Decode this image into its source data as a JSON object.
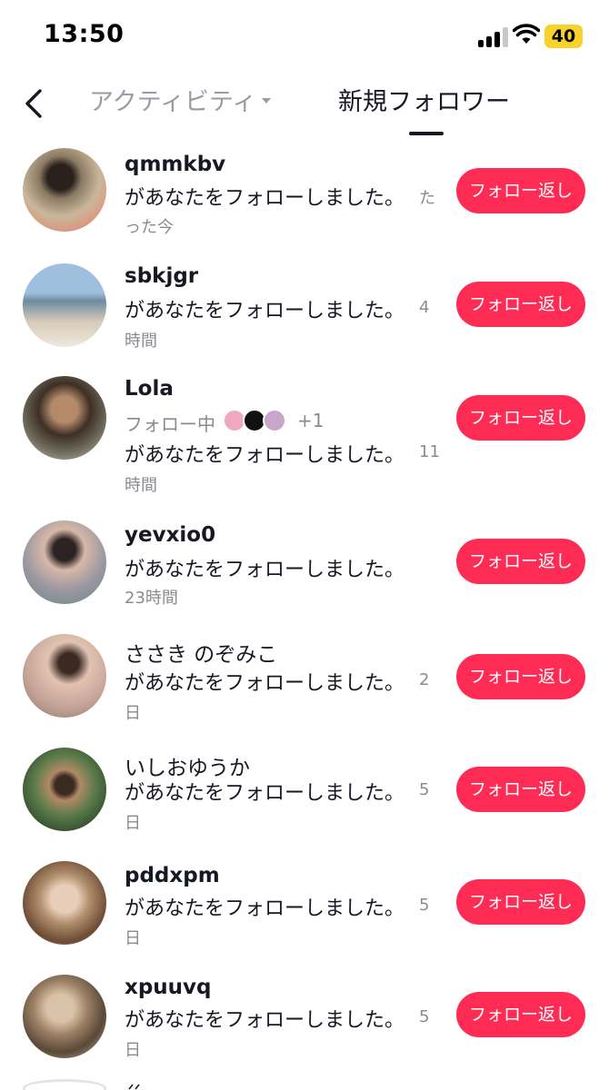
{
  "status_bar": {
    "time": "13:50",
    "battery": "40"
  },
  "header": {
    "tabs": [
      {
        "label": "アクティビティ",
        "active": false,
        "has_dropdown": true
      },
      {
        "label": "新規フォロワー",
        "active": true
      }
    ],
    "back_icon": "chevron-left-icon"
  },
  "colors": {
    "accent": "#fe2c55",
    "text_primary": "#161823",
    "text_secondary": "#8a8b91",
    "battery": "#f7d32a"
  },
  "followers": [
    {
      "username": "qmmkbv",
      "message": "があなたをフォローしました。",
      "time_inline": "た",
      "time_wrap": "った今",
      "button": "フォロー返し"
    },
    {
      "username": "sbkjgr",
      "message": "があなたをフォローしました。",
      "time_inline": "4",
      "time_wrap": "時間",
      "button": "フォロー返し"
    },
    {
      "username": "Lola",
      "following_label": "フォロー中",
      "following_more": "+1",
      "message": "があなたをフォローしました。",
      "time_inline": "11",
      "time_wrap": "時間",
      "button": "フォロー返し"
    },
    {
      "username": "yevxio0",
      "message": "があなたをフォローしました。",
      "time_inline": "",
      "time_wrap": "23時間",
      "button": "フォロー返し"
    },
    {
      "username": "ささき のぞみこ",
      "message": "があなたをフォローしました。",
      "time_inline": "2",
      "time_wrap": "日",
      "button": "フォロー返し"
    },
    {
      "username": "いしおゆうか",
      "message": "があなたをフォローしました。",
      "time_inline": "5",
      "time_wrap": "日",
      "button": "フォロー返し"
    },
    {
      "username": "pddxpm",
      "message": "があなたをフォローしました。",
      "time_inline": "5",
      "time_wrap": "日",
      "button": "フォロー返し"
    },
    {
      "username": "xpuuvq",
      "message": "があなたをフォローしました。",
      "time_inline": "5",
      "time_wrap": "日",
      "button": "フォロー返し"
    }
  ]
}
